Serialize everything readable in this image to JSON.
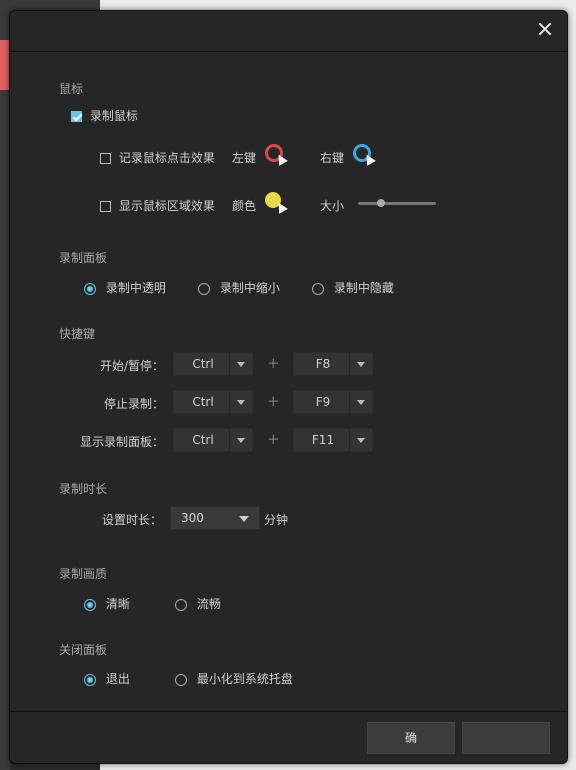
{
  "mouse_section": {
    "title": "鼠标",
    "record_mouse": {
      "label": "录制鼠标",
      "checked": true
    },
    "click_effect": {
      "label": "记录鼠标点击效果",
      "checked": false,
      "left_label": "左键",
      "right_label": "右键",
      "left_color": "#e0454a",
      "right_color": "#3aa8e0"
    },
    "area_effect": {
      "label": "显示鼠标区域效果",
      "checked": false,
      "color_label": "颜色",
      "color": "#e6d94a",
      "size_label": "大小",
      "size_value": 0.3
    }
  },
  "panel_section": {
    "title": "录制面板",
    "options": [
      {
        "label": "录制中透明",
        "selected": true
      },
      {
        "label": "录制中缩小",
        "selected": false
      },
      {
        "label": "录制中隐藏",
        "selected": false
      }
    ]
  },
  "hotkey_section": {
    "title": "快捷键",
    "plus": "+",
    "rows": [
      {
        "label": "开始/暂停：",
        "modifier": "Ctrl",
        "key": "F8"
      },
      {
        "label": "停止录制：",
        "modifier": "Ctrl",
        "key": "F9"
      },
      {
        "label": "显示录制面板：",
        "modifier": "Ctrl",
        "key": "F11"
      }
    ]
  },
  "duration_section": {
    "title": "录制时长",
    "label": "设置时长：",
    "value": "300",
    "unit": "分钟"
  },
  "quality_section": {
    "title": "录制画质",
    "options": [
      {
        "label": "清晰",
        "selected": true
      },
      {
        "label": "流畅",
        "selected": false
      }
    ]
  },
  "close_section": {
    "title": "关闭面板",
    "options": [
      {
        "label": "退出",
        "selected": true
      },
      {
        "label": "最小化到系统托盘",
        "selected": false
      }
    ]
  },
  "footer": {
    "ok_label": "确"
  },
  "colors": {
    "accent": "#6bc4e8",
    "dialog_bg": "#262626"
  }
}
